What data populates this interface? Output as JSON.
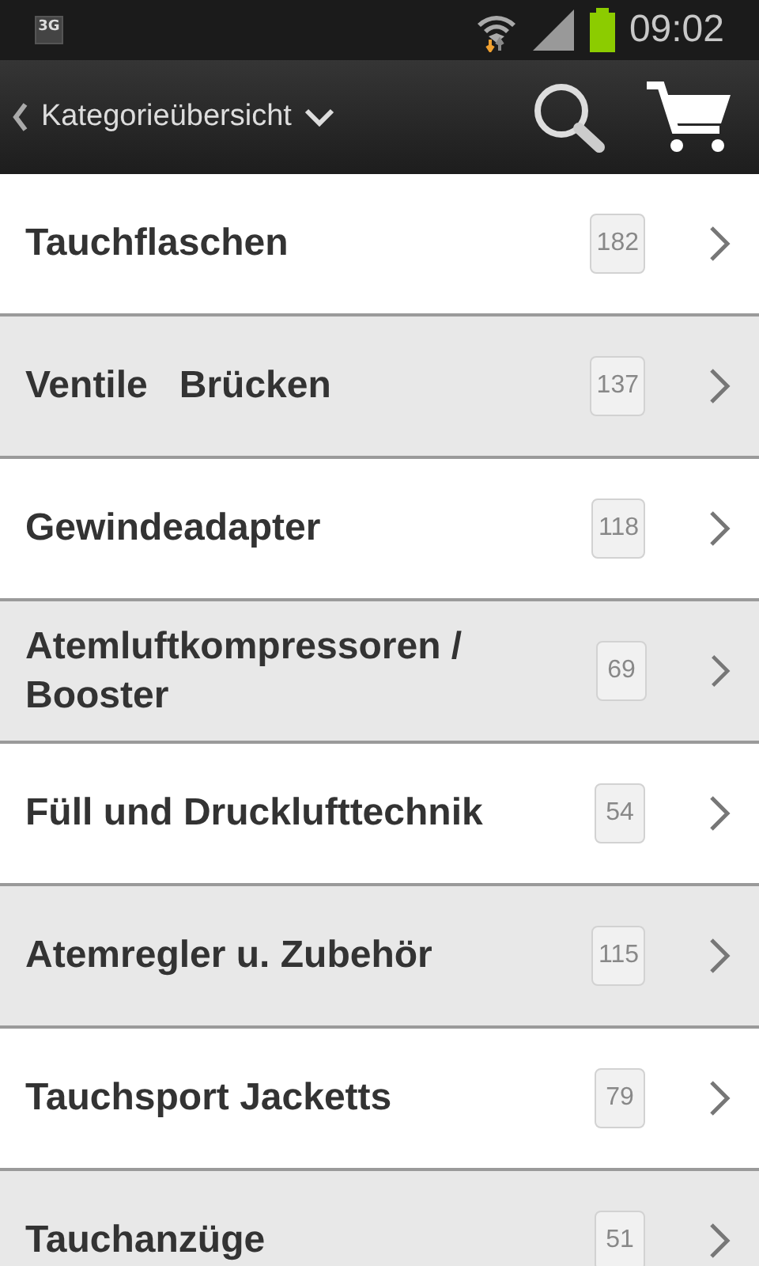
{
  "status_bar": {
    "network": "3G",
    "time": "09:02"
  },
  "action_bar": {
    "title": "Kategorieübersicht"
  },
  "categories": [
    {
      "name": "Tauchflaschen",
      "count": "182"
    },
    {
      "name": "Ventile   Brücken",
      "count": "137"
    },
    {
      "name": "Gewindeadapter",
      "count": "118"
    },
    {
      "name": "Atemluftkompressoren / Booster",
      "count": "69"
    },
    {
      "name": "Füll und Drucklufttechnik",
      "count": "54"
    },
    {
      "name": "Atemregler u. Zubehör",
      "count": "115"
    },
    {
      "name": "Tauchsport Jacketts",
      "count": "79"
    },
    {
      "name": "Tauchanzüge",
      "count": "51"
    }
  ]
}
